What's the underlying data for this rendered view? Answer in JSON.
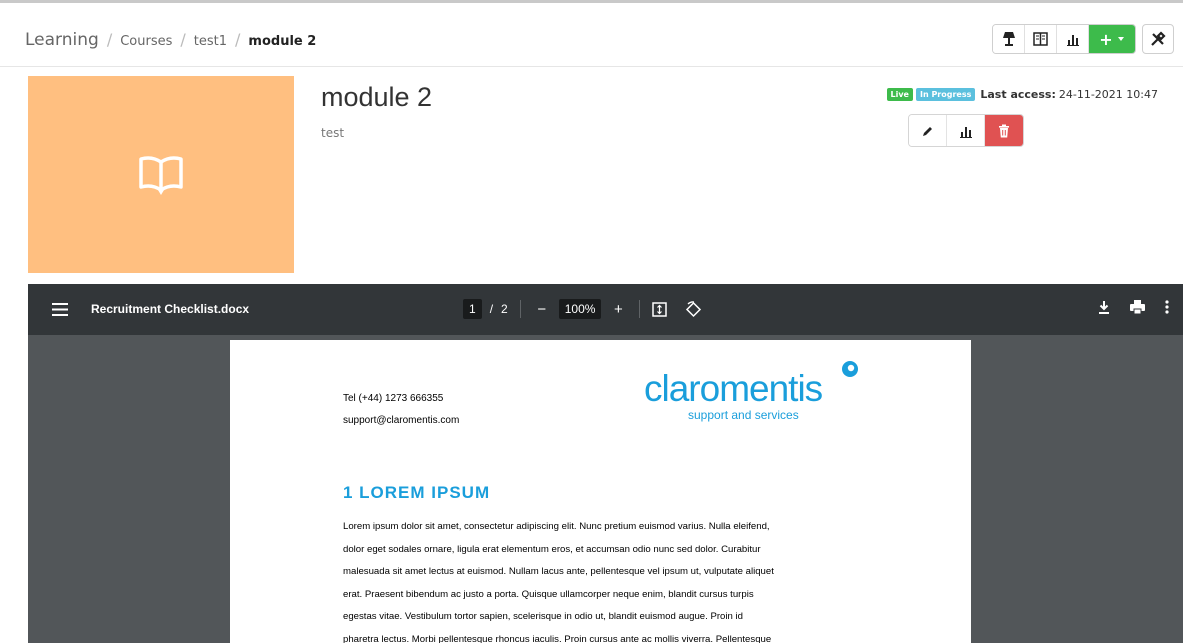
{
  "breadcrumb": {
    "root": "Learning",
    "items": [
      "Courses",
      "test1"
    ],
    "current": "module 2",
    "separator": "/"
  },
  "toolbar": {
    "icons": [
      "lamp-icon",
      "book-icon",
      "bar-chart-icon"
    ],
    "add_label": "+",
    "tools_icon": "tools-icon"
  },
  "module": {
    "title": "module 2",
    "description": "test",
    "thumbnail_color": "#ffbf80",
    "thumbnail_icon": "book-open-icon"
  },
  "status": {
    "live_badge": "Live",
    "progress_badge": "In Progress",
    "last_access_label": "Last access:",
    "last_access_value": "24-11-2021 10:47"
  },
  "actions": [
    "edit-icon",
    "bar-chart-icon",
    "trash-icon"
  ],
  "viewer": {
    "file_name": "Recruitment Checklist.docx",
    "current_page": "1",
    "page_separator": "/",
    "total_pages": "2",
    "zoom": "100%",
    "zoom_out": "−",
    "zoom_in": "+"
  },
  "document": {
    "phone": "Tel (+44) 1273 666355",
    "email": "support@claromentis.com",
    "logo_text": "claromentis",
    "logo_subtext": "support and services",
    "heading": "1 LOREM IPSUM",
    "lines": [
      "Lorem ipsum dolor sit amet, consectetur adipiscing elit. Nunc pretium euismod varius. Nulla eleifend,",
      "dolor eget sodales ornare, ligula erat elementum eros, et accumsan odio nunc sed dolor. Curabitur",
      "malesuada sit amet lectus at euismod. Nullam lacus ante, pellentesque vel ipsum ut, vulputate aliquet",
      "erat. Praesent bibendum ac justo a porta. Quisque ullamcorper neque enim, blandit cursus turpis",
      "egestas vitae. Vestibulum tortor sapien, scelerisque in odio ut, blandit euismod augue. Proin id",
      "pharetra lectus. Morbi pellentesque rhoncus iaculis. Proin cursus ante ac mollis viverra. Pellentesque"
    ]
  },
  "colors": {
    "accent_green": "#3dbb4b",
    "info_blue": "#5bc0de",
    "danger_red": "#e05252",
    "brand_blue": "#1a9edb",
    "viewer_bar": "#323639"
  }
}
